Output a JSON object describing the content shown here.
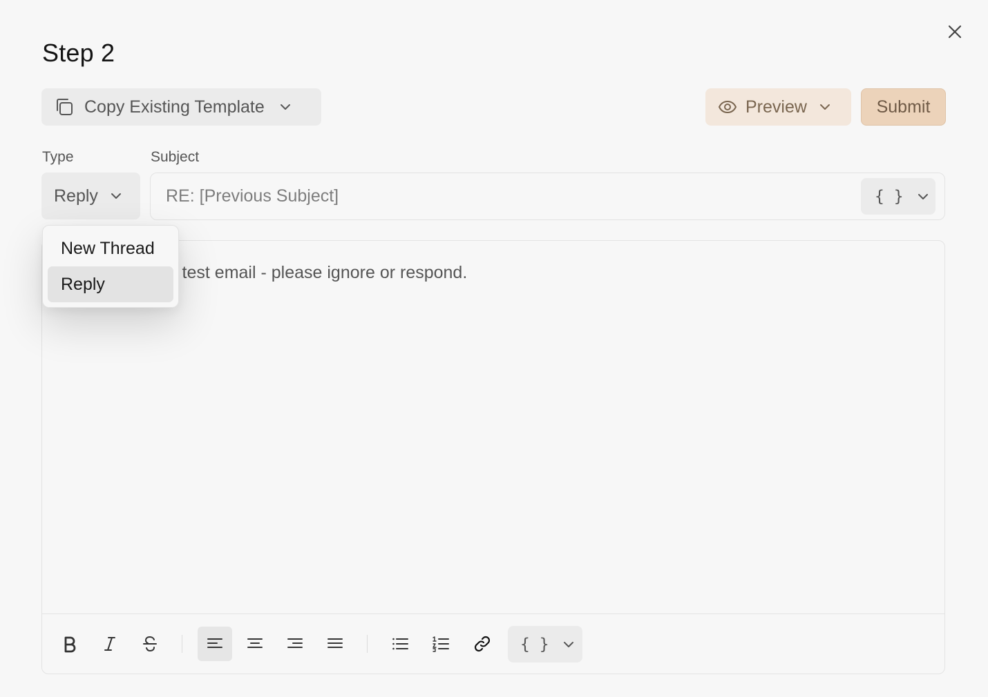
{
  "dialog": {
    "title": "Step 2",
    "close_icon": "close-icon"
  },
  "toolbar_top": {
    "copy_template_label": "Copy Existing Template",
    "preview_label": "Preview",
    "submit_label": "Submit"
  },
  "type_field": {
    "label": "Type",
    "value": "Reply",
    "options": [
      "New Thread",
      "Reply"
    ],
    "selected": "Reply"
  },
  "subject_field": {
    "label": "Subject",
    "placeholder": "RE: [Previous Subject]",
    "variables_label": "{ }"
  },
  "editor": {
    "visible_text": "n my previous test email - please ignore or respond.",
    "toolbar": {
      "variables_label": "{ }",
      "buttons": [
        "bold-icon",
        "italic-icon",
        "strikethrough-icon",
        "align-left-icon",
        "align-center-icon",
        "align-right-icon",
        "align-justify-icon",
        "bullet-list-icon",
        "numbered-list-icon",
        "link-icon"
      ],
      "active_button": "align-left-icon"
    }
  },
  "colors": {
    "background": "#f7f7f7",
    "preview_bg": "#f3e7dc",
    "submit_bg": "#ecd3ba",
    "button_gray": "#ebebeb"
  }
}
